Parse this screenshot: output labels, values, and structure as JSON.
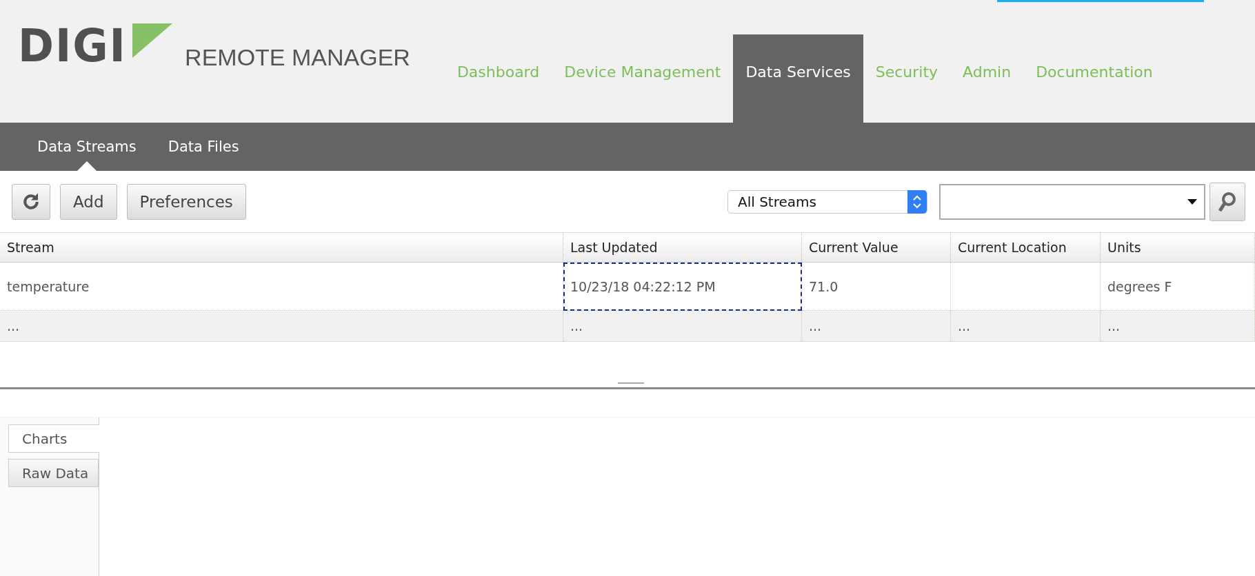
{
  "logo": {
    "brand": "DIGI",
    "product": "REMOTE MANAGER"
  },
  "nav": [
    {
      "label": "Dashboard",
      "selected": false
    },
    {
      "label": "Device Management",
      "selected": false
    },
    {
      "label": "Data Services",
      "selected": true
    },
    {
      "label": "Security",
      "selected": false
    },
    {
      "label": "Admin",
      "selected": false
    },
    {
      "label": "Documentation",
      "selected": false
    }
  ],
  "subnav": [
    {
      "label": "Data Streams",
      "selected": true
    },
    {
      "label": "Data Files",
      "selected": false
    }
  ],
  "toolbar": {
    "buttons": [
      "Add",
      "Preferences"
    ],
    "filter": {
      "value": "All Streams"
    }
  },
  "table": {
    "columns": [
      "Stream",
      "Last Updated",
      "Current Value",
      "Current Location",
      "Units"
    ],
    "rows": [
      {
        "cells": [
          {
            "text": "temperature",
            "focused": false
          },
          {
            "text": "10/23/18 04:22:12 PM",
            "focused": true
          },
          {
            "text": "71.0",
            "focused": false
          },
          {
            "text": "",
            "focused": false
          },
          {
            "text": "degrees F",
            "focused": false
          }
        ]
      },
      {
        "cells": [
          {
            "text": "...",
            "focused": false
          },
          {
            "text": "...",
            "focused": false
          },
          {
            "text": "...",
            "focused": false
          },
          {
            "text": "...",
            "focused": false
          },
          {
            "text": "...",
            "focused": false
          }
        ]
      }
    ]
  },
  "side_tabs": [
    {
      "label": "Charts",
      "selected": true
    },
    {
      "label": "Raw Data",
      "selected": false
    }
  ]
}
